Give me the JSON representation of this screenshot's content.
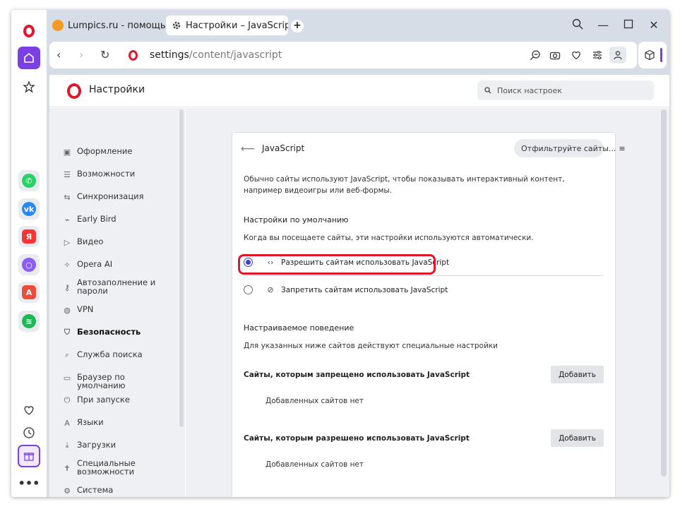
{
  "tabs": [
    {
      "title": "Lumpics.ru - помощь с ко"
    },
    {
      "title": "Настройки – JavaScript"
    }
  ],
  "address_bar": {
    "url_host": "settings",
    "url_path": "/content/javascript"
  },
  "settings_header": {
    "title": "Настройки",
    "search_placeholder": "Поиск настроек"
  },
  "nav": {
    "items": [
      {
        "label": "Оформление",
        "icon": "palette-icon"
      },
      {
        "label": "Возможности",
        "icon": "list-icon"
      },
      {
        "label": "Синхронизация",
        "icon": "sync-icon"
      },
      {
        "label": "Early Bird",
        "icon": "bird-icon"
      },
      {
        "label": "Видео",
        "icon": "play-icon"
      },
      {
        "label": "Opera AI",
        "icon": "sparkle-icon"
      },
      {
        "label": "Автозаполнение и пароли",
        "icon": "key-icon"
      },
      {
        "label": "VPN",
        "icon": "globe-icon"
      },
      {
        "label": "Безопасность",
        "icon": "shield-icon",
        "active": true
      },
      {
        "label": "Служба поиска",
        "icon": "search-icon"
      },
      {
        "label": "Браузер по умолчанию",
        "icon": "window-icon"
      },
      {
        "label": "При запуске",
        "icon": "power-icon"
      },
      {
        "label": "Языки",
        "icon": "translate-icon"
      },
      {
        "label": "Загрузки",
        "icon": "download-icon"
      },
      {
        "label": "Специальные возможности",
        "icon": "accessibility-icon"
      },
      {
        "label": "Система",
        "icon": "wrench-icon"
      }
    ]
  },
  "content": {
    "title": "JavaScript",
    "filter_label": "Отфильтруйте сайты...",
    "description": "Обычно сайты используют JavaScript, чтобы показывать интерактивный контент, например видеоигры или веб-формы.",
    "default_heading": "Настройки по умолчанию",
    "default_sub": "Когда вы посещаете сайты, эти настройки используются автоматически.",
    "option_allow": "Разрешить сайтам использовать JavaScript",
    "option_block": "Запретить сайтам использовать JavaScript",
    "selected_option": "allow",
    "custom_heading": "Настраиваемое поведение",
    "custom_sub": "Для указанных ниже сайтов действуют специальные настройки",
    "blocked_heading": "Сайты, которым запрещено использовать JavaScript",
    "blocked_empty": "Добавленных сайтов нет",
    "allowed_heading": "Сайты, которым разрешено использовать JavaScript",
    "allowed_empty": "Добавленных сайтов нет",
    "add_label": "Добавить"
  },
  "colors": {
    "accent": "#7b3fe4",
    "opera_red": "#e0162b",
    "radio_selected": "#3c3ce0",
    "highlight": "#e0162b"
  }
}
